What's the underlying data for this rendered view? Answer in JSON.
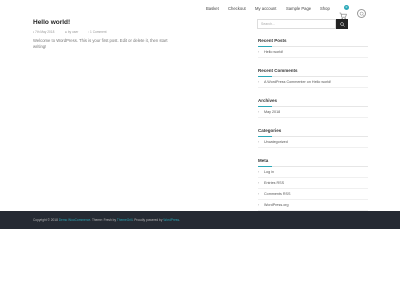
{
  "nav": {
    "items": [
      {
        "label": "Basket"
      },
      {
        "label": "Checkout"
      },
      {
        "label": "My account"
      },
      {
        "label": "Sample Page"
      },
      {
        "label": "Shop"
      }
    ],
    "cart_count": "0"
  },
  "post": {
    "title": "Hello world!",
    "date": "7th May 2018",
    "author": "by user",
    "comments": "1 Comment",
    "body": "Welcome to WordPress. This is your first post. Edit or delete it, then start writing!"
  },
  "sidebar": {
    "search_placeholder": "Search...",
    "recent_posts": {
      "title": "Recent Posts",
      "items": [
        "Hello world!"
      ]
    },
    "recent_comments": {
      "title": "Recent Comments",
      "author": "A WordPress Commenter",
      "on": "on",
      "post": "Hello world!"
    },
    "archives": {
      "title": "Archives",
      "items": [
        "May 2018"
      ]
    },
    "categories": {
      "title": "Categories",
      "items": [
        "Uncategorized"
      ]
    },
    "meta": {
      "title": "Meta",
      "items": [
        "Log in",
        "Entries RSS",
        "Comments RSS",
        "WordPress.org"
      ]
    }
  },
  "footer": {
    "copyright": "Copyright © 2018",
    "site": "Demo WooCommerce",
    "theme_text": "Theme: Fresh by",
    "theme_author": "ThemeGrill",
    "proudly": "Proudly powered by",
    "wp": "WordPress"
  },
  "colors": {
    "accent": "#2aa8b8",
    "footer_bg": "#252a33"
  }
}
